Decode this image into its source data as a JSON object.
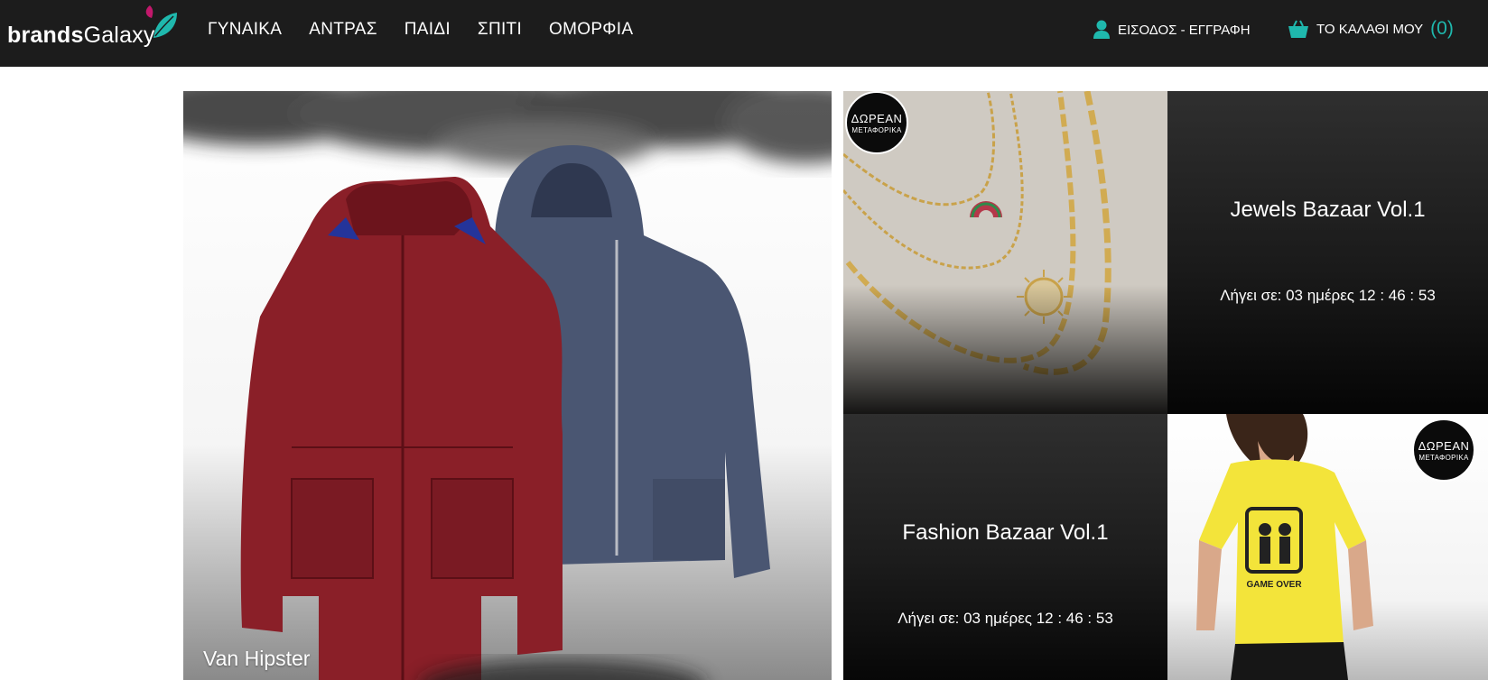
{
  "header": {
    "logo_bold": "brands",
    "logo_light": "Galaxy",
    "nav": [
      "ΓΥΝΑΙΚΑ",
      "ΑΝΤΡΑΣ",
      "ΠΑΙΔΙ",
      "ΣΠΙΤΙ",
      "ΟΜΟΡΦΙΑ"
    ],
    "account_label": "ΕΙΣΟΔΟΣ - ΕΓΓΡΑΦΗ",
    "account_icon": "user-icon",
    "cart_label": "ΤΟ ΚΑΛΑΘΙ ΜΟΥ",
    "cart_count": "(0)",
    "cart_icon": "basket-icon"
  },
  "tiles": {
    "hero": {
      "label": "Van Hipster"
    },
    "jewels": {
      "title": "Jewels Bazaar Vol.1",
      "timer": "Λήγει σε: 03 ημέρες 12 : 46 : 53",
      "badge_line1": "ΔΩΡΕΑΝ",
      "badge_line2": "ΜΕΤΑΦΟΡΙΚΑ"
    },
    "fashion": {
      "title": "Fashion Bazaar Vol.1",
      "timer": "Λήγει σε: 03 ημέρες 12 : 46 : 53",
      "badge_line1": "ΔΩΡΕΑΝ",
      "badge_line2": "ΜΕΤΑΦΟΡΙΚΑ",
      "shirt_text": "GAME OVER"
    }
  },
  "colors": {
    "header_bg": "#1c1c1c",
    "accent_teal": "#1fb8ad",
    "logo_leaf_pink": "#c2186b"
  }
}
